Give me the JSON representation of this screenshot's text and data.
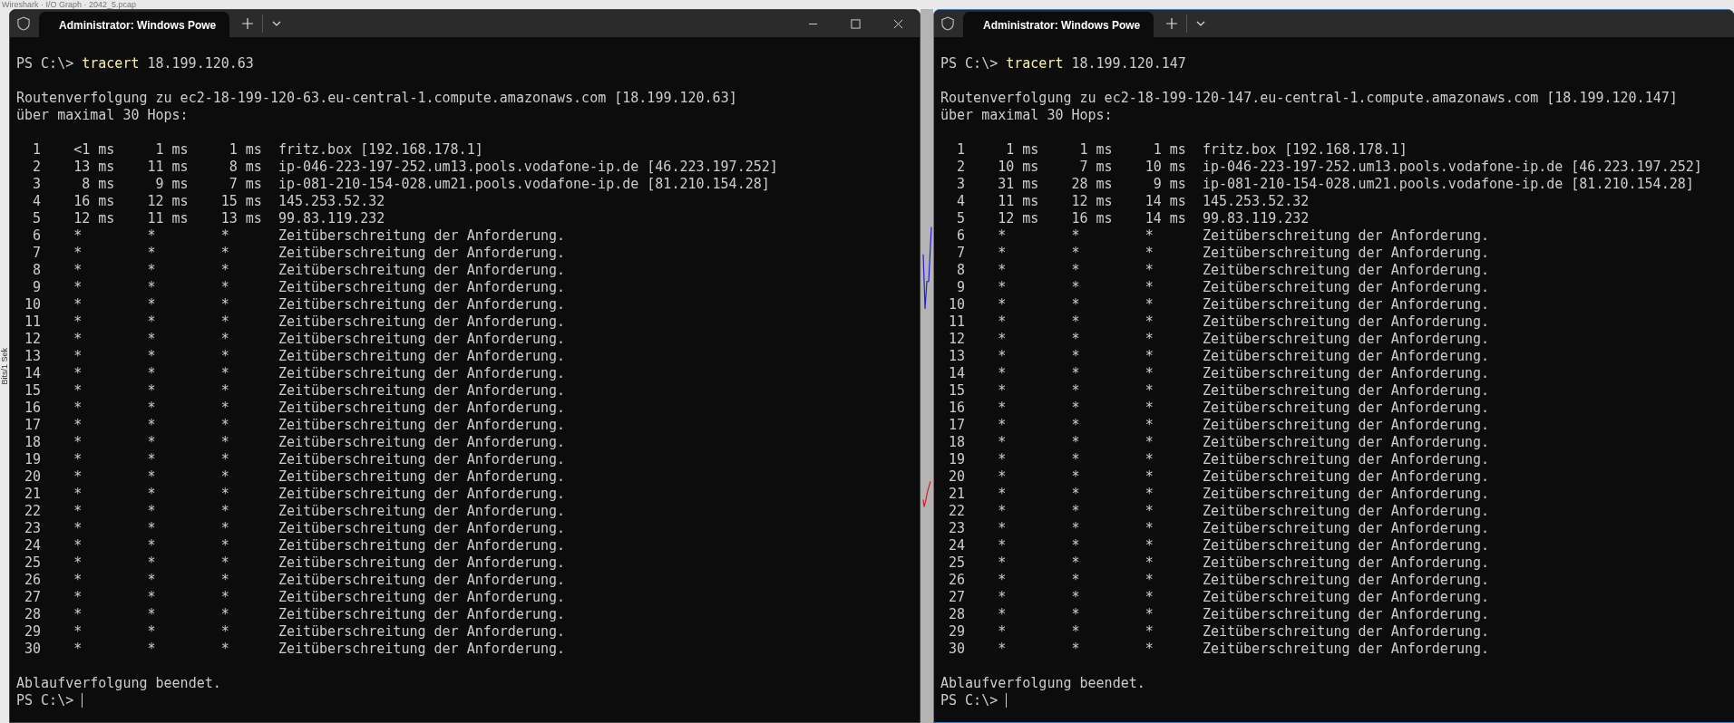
{
  "background_window": {
    "title": "Wireshark · I/O Graph · 2042_5.pcap",
    "axis_label": "Bits/1 Sek"
  },
  "terminals": [
    {
      "focused": false,
      "controls_visible": true,
      "tab": {
        "title": "Administrator: Windows Powe"
      },
      "prompt": "PS C:\\>",
      "command": "tracert",
      "argument": "18.199.120.63",
      "header": [
        "Routenverfolgung zu ec2-18-199-120-63.eu-central-1.compute.amazonaws.com [18.199.120.63]",
        "über maximal 30 Hops:"
      ],
      "hops": [
        {
          "hop": "1",
          "kind": "reply",
          "times": [
            "<1 ms",
            "1 ms",
            "1 ms"
          ],
          "host": "fritz.box [192.168.178.1]"
        },
        {
          "hop": "2",
          "kind": "reply",
          "times": [
            "13 ms",
            "11 ms",
            "8 ms"
          ],
          "host": "ip-046-223-197-252.um13.pools.vodafone-ip.de [46.223.197.252]"
        },
        {
          "hop": "3",
          "kind": "reply",
          "times": [
            "8 ms",
            "9 ms",
            "7 ms"
          ],
          "host": "ip-081-210-154-028.um21.pools.vodafone-ip.de [81.210.154.28]"
        },
        {
          "hop": "4",
          "kind": "reply",
          "times": [
            "16 ms",
            "12 ms",
            "15 ms"
          ],
          "host": "145.253.52.32"
        },
        {
          "hop": "5",
          "kind": "reply",
          "times": [
            "12 ms",
            "11 ms",
            "13 ms"
          ],
          "host": "99.83.119.232"
        },
        {
          "hop": "6",
          "kind": "timeout",
          "times": [
            "*",
            "*",
            "*"
          ],
          "host": "Zeitüberschreitung der Anforderung."
        },
        {
          "hop": "7",
          "kind": "timeout",
          "times": [
            "*",
            "*",
            "*"
          ],
          "host": "Zeitüberschreitung der Anforderung."
        },
        {
          "hop": "8",
          "kind": "timeout",
          "times": [
            "*",
            "*",
            "*"
          ],
          "host": "Zeitüberschreitung der Anforderung."
        },
        {
          "hop": "9",
          "kind": "timeout",
          "times": [
            "*",
            "*",
            "*"
          ],
          "host": "Zeitüberschreitung der Anforderung."
        },
        {
          "hop": "10",
          "kind": "timeout",
          "times": [
            "*",
            "*",
            "*"
          ],
          "host": "Zeitüberschreitung der Anforderung."
        },
        {
          "hop": "11",
          "kind": "timeout",
          "times": [
            "*",
            "*",
            "*"
          ],
          "host": "Zeitüberschreitung der Anforderung."
        },
        {
          "hop": "12",
          "kind": "timeout",
          "times": [
            "*",
            "*",
            "*"
          ],
          "host": "Zeitüberschreitung der Anforderung."
        },
        {
          "hop": "13",
          "kind": "timeout",
          "times": [
            "*",
            "*",
            "*"
          ],
          "host": "Zeitüberschreitung der Anforderung."
        },
        {
          "hop": "14",
          "kind": "timeout",
          "times": [
            "*",
            "*",
            "*"
          ],
          "host": "Zeitüberschreitung der Anforderung."
        },
        {
          "hop": "15",
          "kind": "timeout",
          "times": [
            "*",
            "*",
            "*"
          ],
          "host": "Zeitüberschreitung der Anforderung."
        },
        {
          "hop": "16",
          "kind": "timeout",
          "times": [
            "*",
            "*",
            "*"
          ],
          "host": "Zeitüberschreitung der Anforderung."
        },
        {
          "hop": "17",
          "kind": "timeout",
          "times": [
            "*",
            "*",
            "*"
          ],
          "host": "Zeitüberschreitung der Anforderung."
        },
        {
          "hop": "18",
          "kind": "timeout",
          "times": [
            "*",
            "*",
            "*"
          ],
          "host": "Zeitüberschreitung der Anforderung."
        },
        {
          "hop": "19",
          "kind": "timeout",
          "times": [
            "*",
            "*",
            "*"
          ],
          "host": "Zeitüberschreitung der Anforderung."
        },
        {
          "hop": "20",
          "kind": "timeout",
          "times": [
            "*",
            "*",
            "*"
          ],
          "host": "Zeitüberschreitung der Anforderung."
        },
        {
          "hop": "21",
          "kind": "timeout",
          "times": [
            "*",
            "*",
            "*"
          ],
          "host": "Zeitüberschreitung der Anforderung."
        },
        {
          "hop": "22",
          "kind": "timeout",
          "times": [
            "*",
            "*",
            "*"
          ],
          "host": "Zeitüberschreitung der Anforderung."
        },
        {
          "hop": "23",
          "kind": "timeout",
          "times": [
            "*",
            "*",
            "*"
          ],
          "host": "Zeitüberschreitung der Anforderung."
        },
        {
          "hop": "24",
          "kind": "timeout",
          "times": [
            "*",
            "*",
            "*"
          ],
          "host": "Zeitüberschreitung der Anforderung."
        },
        {
          "hop": "25",
          "kind": "timeout",
          "times": [
            "*",
            "*",
            "*"
          ],
          "host": "Zeitüberschreitung der Anforderung."
        },
        {
          "hop": "26",
          "kind": "timeout",
          "times": [
            "*",
            "*",
            "*"
          ],
          "host": "Zeitüberschreitung der Anforderung."
        },
        {
          "hop": "27",
          "kind": "timeout",
          "times": [
            "*",
            "*",
            "*"
          ],
          "host": "Zeitüberschreitung der Anforderung."
        },
        {
          "hop": "28",
          "kind": "timeout",
          "times": [
            "*",
            "*",
            "*"
          ],
          "host": "Zeitüberschreitung der Anforderung."
        },
        {
          "hop": "29",
          "kind": "timeout",
          "times": [
            "*",
            "*",
            "*"
          ],
          "host": "Zeitüberschreitung der Anforderung."
        },
        {
          "hop": "30",
          "kind": "timeout",
          "times": [
            "*",
            "*",
            "*"
          ],
          "host": "Zeitüberschreitung der Anforderung."
        }
      ],
      "footer": "Ablaufverfolgung beendet.",
      "final_prompt": "PS C:\\>"
    },
    {
      "focused": true,
      "controls_visible": false,
      "tab": {
        "title": "Administrator: Windows Powe"
      },
      "prompt": "PS C:\\>",
      "command": "tracert",
      "argument": "18.199.120.147",
      "header": [
        "Routenverfolgung zu ec2-18-199-120-147.eu-central-1.compute.amazonaws.com [18.199.120.147]",
        "über maximal 30 Hops:"
      ],
      "hops": [
        {
          "hop": "1",
          "kind": "reply",
          "times": [
            "1 ms",
            "1 ms",
            "1 ms"
          ],
          "host": "fritz.box [192.168.178.1]"
        },
        {
          "hop": "2",
          "kind": "reply",
          "times": [
            "10 ms",
            "7 ms",
            "10 ms"
          ],
          "host": "ip-046-223-197-252.um13.pools.vodafone-ip.de [46.223.197.252]"
        },
        {
          "hop": "3",
          "kind": "reply",
          "times": [
            "31 ms",
            "28 ms",
            "9 ms"
          ],
          "host": "ip-081-210-154-028.um21.pools.vodafone-ip.de [81.210.154.28]"
        },
        {
          "hop": "4",
          "kind": "reply",
          "times": [
            "11 ms",
            "12 ms",
            "14 ms"
          ],
          "host": "145.253.52.32"
        },
        {
          "hop": "5",
          "kind": "reply",
          "times": [
            "12 ms",
            "16 ms",
            "14 ms"
          ],
          "host": "99.83.119.232"
        },
        {
          "hop": "6",
          "kind": "timeout",
          "times": [
            "*",
            "*",
            "*"
          ],
          "host": "Zeitüberschreitung der Anforderung."
        },
        {
          "hop": "7",
          "kind": "timeout",
          "times": [
            "*",
            "*",
            "*"
          ],
          "host": "Zeitüberschreitung der Anforderung."
        },
        {
          "hop": "8",
          "kind": "timeout",
          "times": [
            "*",
            "*",
            "*"
          ],
          "host": "Zeitüberschreitung der Anforderung."
        },
        {
          "hop": "9",
          "kind": "timeout",
          "times": [
            "*",
            "*",
            "*"
          ],
          "host": "Zeitüberschreitung der Anforderung."
        },
        {
          "hop": "10",
          "kind": "timeout",
          "times": [
            "*",
            "*",
            "*"
          ],
          "host": "Zeitüberschreitung der Anforderung."
        },
        {
          "hop": "11",
          "kind": "timeout",
          "times": [
            "*",
            "*",
            "*"
          ],
          "host": "Zeitüberschreitung der Anforderung."
        },
        {
          "hop": "12",
          "kind": "timeout",
          "times": [
            "*",
            "*",
            "*"
          ],
          "host": "Zeitüberschreitung der Anforderung."
        },
        {
          "hop": "13",
          "kind": "timeout",
          "times": [
            "*",
            "*",
            "*"
          ],
          "host": "Zeitüberschreitung der Anforderung."
        },
        {
          "hop": "14",
          "kind": "timeout",
          "times": [
            "*",
            "*",
            "*"
          ],
          "host": "Zeitüberschreitung der Anforderung."
        },
        {
          "hop": "15",
          "kind": "timeout",
          "times": [
            "*",
            "*",
            "*"
          ],
          "host": "Zeitüberschreitung der Anforderung."
        },
        {
          "hop": "16",
          "kind": "timeout",
          "times": [
            "*",
            "*",
            "*"
          ],
          "host": "Zeitüberschreitung der Anforderung."
        },
        {
          "hop": "17",
          "kind": "timeout",
          "times": [
            "*",
            "*",
            "*"
          ],
          "host": "Zeitüberschreitung der Anforderung."
        },
        {
          "hop": "18",
          "kind": "timeout",
          "times": [
            "*",
            "*",
            "*"
          ],
          "host": "Zeitüberschreitung der Anforderung."
        },
        {
          "hop": "19",
          "kind": "timeout",
          "times": [
            "*",
            "*",
            "*"
          ],
          "host": "Zeitüberschreitung der Anforderung."
        },
        {
          "hop": "20",
          "kind": "timeout",
          "times": [
            "*",
            "*",
            "*"
          ],
          "host": "Zeitüberschreitung der Anforderung."
        },
        {
          "hop": "21",
          "kind": "timeout",
          "times": [
            "*",
            "*",
            "*"
          ],
          "host": "Zeitüberschreitung der Anforderung."
        },
        {
          "hop": "22",
          "kind": "timeout",
          "times": [
            "*",
            "*",
            "*"
          ],
          "host": "Zeitüberschreitung der Anforderung."
        },
        {
          "hop": "23",
          "kind": "timeout",
          "times": [
            "*",
            "*",
            "*"
          ],
          "host": "Zeitüberschreitung der Anforderung."
        },
        {
          "hop": "24",
          "kind": "timeout",
          "times": [
            "*",
            "*",
            "*"
          ],
          "host": "Zeitüberschreitung der Anforderung."
        },
        {
          "hop": "25",
          "kind": "timeout",
          "times": [
            "*",
            "*",
            "*"
          ],
          "host": "Zeitüberschreitung der Anforderung."
        },
        {
          "hop": "26",
          "kind": "timeout",
          "times": [
            "*",
            "*",
            "*"
          ],
          "host": "Zeitüberschreitung der Anforderung."
        },
        {
          "hop": "27",
          "kind": "timeout",
          "times": [
            "*",
            "*",
            "*"
          ],
          "host": "Zeitüberschreitung der Anforderung."
        },
        {
          "hop": "28",
          "kind": "timeout",
          "times": [
            "*",
            "*",
            "*"
          ],
          "host": "Zeitüberschreitung der Anforderung."
        },
        {
          "hop": "29",
          "kind": "timeout",
          "times": [
            "*",
            "*",
            "*"
          ],
          "host": "Zeitüberschreitung der Anforderung."
        },
        {
          "hop": "30",
          "kind": "timeout",
          "times": [
            "*",
            "*",
            "*"
          ],
          "host": "Zeitüberschreitung der Anforderung."
        }
      ],
      "footer": "Ablaufverfolgung beendet.",
      "final_prompt": "PS C:\\>"
    }
  ]
}
